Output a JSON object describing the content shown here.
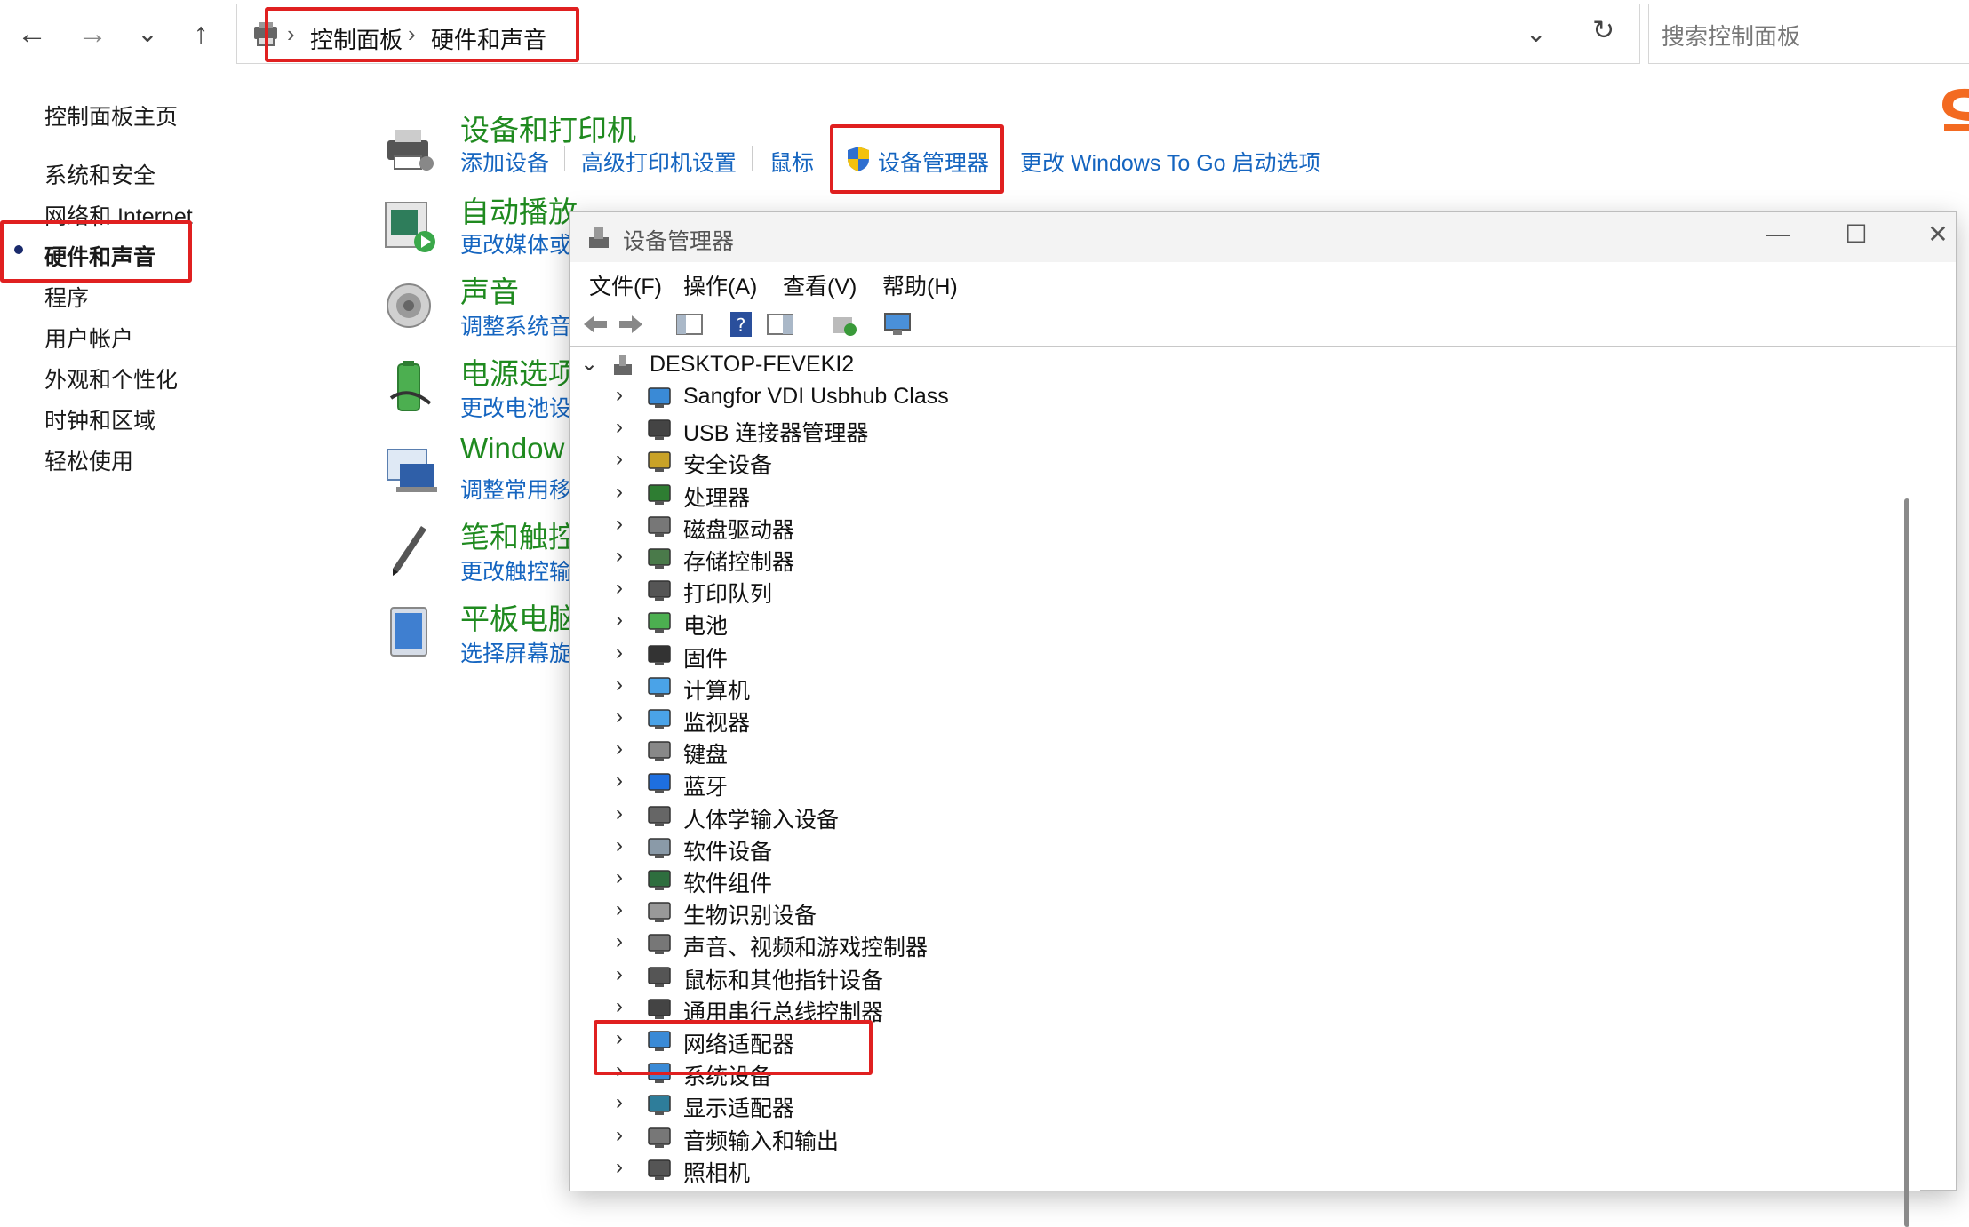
{
  "nav": {
    "back_glyph": "←",
    "forward_glyph": "→",
    "history_glyph": "⌄",
    "up_glyph": "↑"
  },
  "address": {
    "crumbs": [
      "控制面板",
      "硬件和声音"
    ],
    "dropdown_glyph": "⌄",
    "refresh_glyph": "↻"
  },
  "search": {
    "placeholder": "搜索控制面板"
  },
  "left_nav": {
    "items": [
      "控制面板主页",
      "系统和安全",
      "网络和 Internet",
      "硬件和声音",
      "程序",
      "用户帐户",
      "外观和个性化",
      "时钟和区域",
      "轻松使用"
    ],
    "current": "硬件和声音"
  },
  "categories": [
    {
      "title": "设备和打印机",
      "links": [
        "添加设备",
        "高级打印机设置",
        "鼠标",
        "设备管理器",
        "更改 Windows To Go 启动选项"
      ],
      "icon": "printer-icon"
    },
    {
      "title": "自动播放",
      "links": [
        "更改媒体或"
      ],
      "icon": "autoplay-icon"
    },
    {
      "title": "声音",
      "links": [
        "调整系统音"
      ],
      "icon": "speaker-icon"
    },
    {
      "title": "电源选项",
      "links": [
        "更改电池设"
      ],
      "icon": "battery-icon"
    },
    {
      "title": "Window",
      "links": [
        "调整常用移"
      ],
      "icon": "mobility-icon"
    },
    {
      "title": "笔和触控",
      "links": [
        "更改触控输"
      ],
      "icon": "pen-icon"
    },
    {
      "title": "平板电脑",
      "links": [
        "选择屏幕旋"
      ],
      "icon": "tablet-icon"
    }
  ],
  "device_manager": {
    "title": "设备管理器",
    "controls": {
      "minimize": "—",
      "maximize": "☐",
      "close": "✕"
    },
    "menus": [
      "文件(F)",
      "操作(A)",
      "查看(V)",
      "帮助(H)"
    ],
    "root": "DESKTOP-FEVEKI2",
    "root_chevron": "⌄",
    "child_chevron": "›",
    "devices": [
      {
        "label": "Sangfor VDI Usbhub Class",
        "icon": "monitor-network-icon"
      },
      {
        "label": "USB 连接器管理器",
        "icon": "usb-icon"
      },
      {
        "label": "安全设备",
        "icon": "security-key-icon"
      },
      {
        "label": "处理器",
        "icon": "processor-icon"
      },
      {
        "label": "磁盘驱动器",
        "icon": "disk-drive-icon"
      },
      {
        "label": "存储控制器",
        "icon": "storage-controller-icon"
      },
      {
        "label": "打印队列",
        "icon": "printer-queue-icon"
      },
      {
        "label": "电池",
        "icon": "battery-icon"
      },
      {
        "label": "固件",
        "icon": "firmware-icon"
      },
      {
        "label": "计算机",
        "icon": "computer-icon"
      },
      {
        "label": "监视器",
        "icon": "monitor-icon"
      },
      {
        "label": "键盘",
        "icon": "keyboard-icon"
      },
      {
        "label": "蓝牙",
        "icon": "bluetooth-icon"
      },
      {
        "label": "人体学输入设备",
        "icon": "hid-icon"
      },
      {
        "label": "软件设备",
        "icon": "software-device-icon"
      },
      {
        "label": "软件组件",
        "icon": "software-component-icon"
      },
      {
        "label": "生物识别设备",
        "icon": "fingerprint-icon"
      },
      {
        "label": "声音、视频和游戏控制器",
        "icon": "audio-icon"
      },
      {
        "label": "鼠标和其他指针设备",
        "icon": "mouse-icon"
      },
      {
        "label": "通用串行总线控制器",
        "icon": "usb-controller-icon"
      },
      {
        "label": "网络适配器",
        "icon": "network-adapter-icon"
      },
      {
        "label": "系统设备",
        "icon": "system-device-icon"
      },
      {
        "label": "显示适配器",
        "icon": "display-adapter-icon"
      },
      {
        "label": "音频输入和输出",
        "icon": "audio-io-icon"
      },
      {
        "label": "照相机",
        "icon": "camera-icon"
      }
    ]
  },
  "colors": {
    "accent_link": "#1565c0",
    "category_title": "#1f8a1f",
    "highlight_box": "#e02020"
  }
}
